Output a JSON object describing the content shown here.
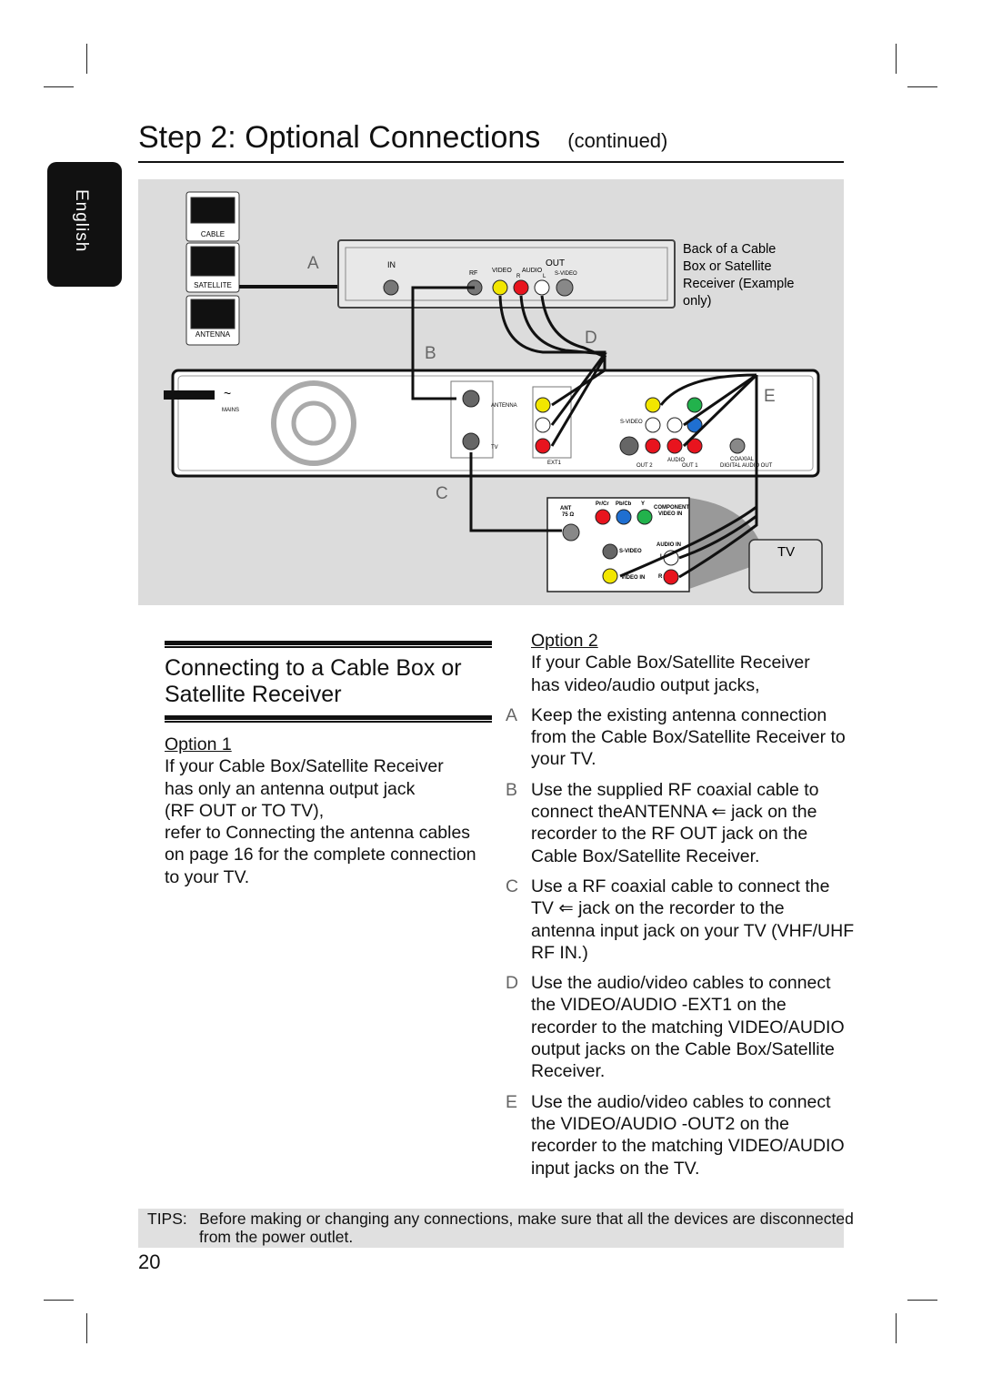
{
  "header": {
    "title": "Step 2: Optional Connections",
    "continued": "(continued)"
  },
  "language_tab": "English",
  "diagram": {
    "labels": {
      "a": "A",
      "b": "B",
      "c": "C",
      "d": "D",
      "e": "E",
      "tv": "TV"
    },
    "source_icons": [
      "CABLE",
      "SATELLITE",
      "ANTENNA"
    ],
    "receiver_caption": [
      "Back of a Cable",
      "Box or Satellite",
      "Receiver (Example",
      "only)"
    ],
    "receiver_jacks": {
      "in": "IN",
      "out": "OUT",
      "rf": "RF",
      "video": "VIDEO",
      "audio": "AUDIO",
      "r": "R",
      "l": "L",
      "svideo": "S-VIDEO"
    },
    "recorder_jacks": {
      "mains": "MAINS",
      "antenna": "ANTENNA",
      "tv": "TV",
      "ext1": "EXT1",
      "svideo": "S-VIDEO",
      "out2": "OUT 2",
      "out1": "OUT 1",
      "audio": "AUDIO",
      "coaxial": "COAXIAL",
      "digital_audio_out": "DIGITAL AUDIO OUT"
    },
    "tv_jacks": {
      "ant": "ANT",
      "ohm": "75 Ω",
      "pr": "Pr/Cr",
      "pb": "Pb/Cb",
      "y": "Y",
      "component1": "COMPONENT",
      "component2": "VIDEO IN",
      "svideo": "S-VIDEO",
      "audio_in": "AUDIO IN",
      "l": "L",
      "r": "R",
      "video_in": "VIDEO IN"
    },
    "colors": {
      "yellow": "#f2e600",
      "red": "#e8141e",
      "white": "#ffffff",
      "green": "#22b24c",
      "blue": "#1f6fd1",
      "background": "#dcdcdc"
    }
  },
  "left": {
    "heading": "Connecting to a Cable Box or Satellite Receiver",
    "option_label": "Option 1",
    "lines": [
      "If your Cable Box/Satellite Receiver",
      "has only an antenna output jack",
      "(RF OUT or TO TV),",
      "refer to  Connecting the antenna cables",
      "on page 16 for the complete connection",
      "to your TV."
    ]
  },
  "right": {
    "option_label": "Option 2",
    "intro": [
      "If your Cable Box/Satellite Receiver",
      "has video/audio output jacks,"
    ],
    "steps": [
      {
        "letter": "A",
        "lines": [
          "Keep the existing antenna connection",
          "from the Cable Box/Satellite Receiver to",
          "your TV."
        ]
      },
      {
        "letter": "B",
        "lines": [
          "Use the supplied RF coaxial cable to",
          "connect theANTENNA    ⇐  jack on the",
          "recorder to the RF OUT jack on the",
          "Cable Box/Satellite Receiver."
        ]
      },
      {
        "letter": "C",
        "lines": [
          "Use a RF coaxial cable to connect the",
          "TV  ⇐  jack on the recorder to the",
          "antenna input jack on your TV (VHF/UHF",
          "RF IN.)"
        ]
      },
      {
        "letter": "D",
        "lines": [
          "Use the audio/video cables to connect",
          "the VIDEO/AUDIO -EXT1    on the",
          "recorder to the matching VIDEO/AUDIO",
          "output jacks on the Cable Box/Satellite",
          "Receiver."
        ]
      },
      {
        "letter": "E",
        "lines": [
          "Use the audio/video cables to connect",
          "the VIDEO/AUDIO -OUT2    on the",
          "recorder to the matching VIDEO/AUDIO",
          "input jacks on the TV."
        ]
      }
    ]
  },
  "tips": {
    "label": "TIPS:",
    "lines": [
      "Before making or changing any connections, make sure that all the devices are disconnected",
      "from the power outlet."
    ]
  },
  "page_number": "20"
}
